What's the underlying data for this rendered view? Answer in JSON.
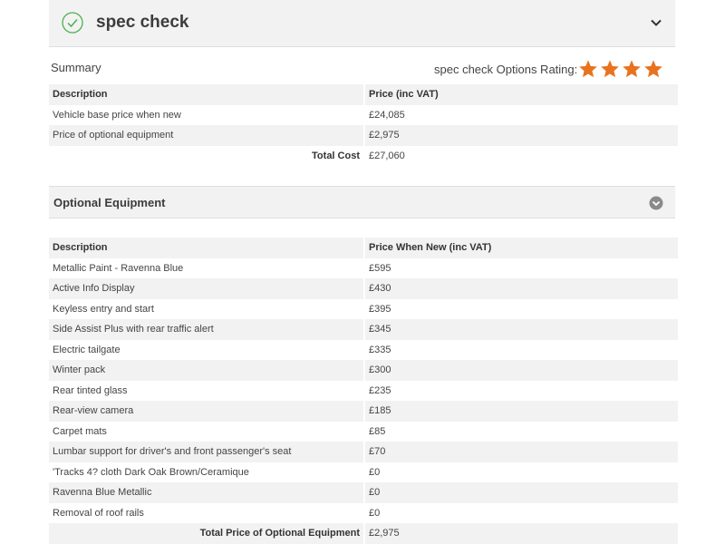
{
  "header": {
    "title": "spec check",
    "check_icon": "check-circle-icon",
    "collapse_icon": "chevron-down-icon",
    "accent_color": "#4caf50"
  },
  "summary": {
    "label": "Summary",
    "rating_label": "spec check Options Rating:",
    "rating": 4,
    "rating_max": 4,
    "star_color": "#e8731f",
    "columns": [
      "Description",
      "Price (inc VAT)"
    ],
    "rows": [
      {
        "description": "Vehicle base price when new",
        "price": "£24,085"
      },
      {
        "description": "Price of optional equipment",
        "price": "£2,975"
      }
    ],
    "total_label": "Total Cost",
    "total_value": "£27,060"
  },
  "optional": {
    "title": "Optional Equipment",
    "toggle_icon": "chevron-down-circle-icon",
    "columns": [
      "Description",
      "Price When New (inc VAT)"
    ],
    "rows": [
      {
        "description": "Metallic Paint - Ravenna Blue",
        "price": "£595"
      },
      {
        "description": "Active Info Display",
        "price": "£430"
      },
      {
        "description": "Keyless entry and start",
        "price": "£395"
      },
      {
        "description": "Side Assist Plus with rear traffic alert",
        "price": "£345"
      },
      {
        "description": "Electric tailgate",
        "price": "£335"
      },
      {
        "description": "Winter pack",
        "price": "£300"
      },
      {
        "description": "Rear tinted glass",
        "price": "£235"
      },
      {
        "description": "Rear-view camera",
        "price": "£185"
      },
      {
        "description": "Carpet mats",
        "price": "£85"
      },
      {
        "description": "Lumbar support for driver's and front passenger's seat",
        "price": "£70"
      },
      {
        "description": "'Tracks 4? cloth Dark Oak Brown/Ceramique",
        "price": "£0"
      },
      {
        "description": "Ravenna Blue Metallic",
        "price": "£0"
      },
      {
        "description": "Removal of roof rails",
        "price": "£0"
      }
    ],
    "total_label": "Total Price of Optional Equipment",
    "total_value": "£2,975"
  }
}
